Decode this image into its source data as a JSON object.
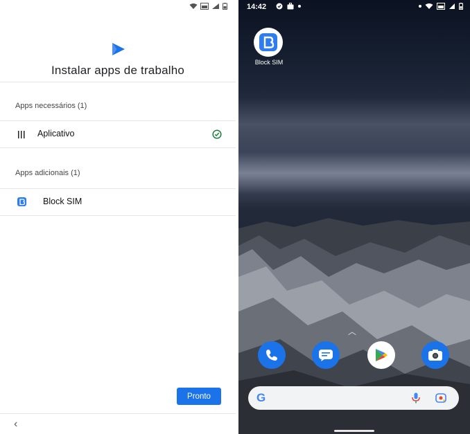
{
  "left": {
    "title": "Instalar apps de trabalho",
    "required_section": "Apps necessários (1)",
    "required_apps": [
      {
        "label": "Aplicativo",
        "icon": "barcode-icon",
        "status": "installed"
      }
    ],
    "additional_section": "Apps adicionais (1)",
    "additional_apps": [
      {
        "label": "Block SIM",
        "icon": "block-sim-icon"
      }
    ],
    "done_button": "Pronto",
    "back_glyph": "‹",
    "accent_color": "#1a73e8",
    "check_color": "#188038"
  },
  "right": {
    "status_time": "14:42",
    "home_app_label": "Block SIM",
    "dock_apps": [
      "phone-icon",
      "messages-icon",
      "play-store-icon",
      "camera-icon"
    ],
    "search_bar_logo": "G"
  }
}
